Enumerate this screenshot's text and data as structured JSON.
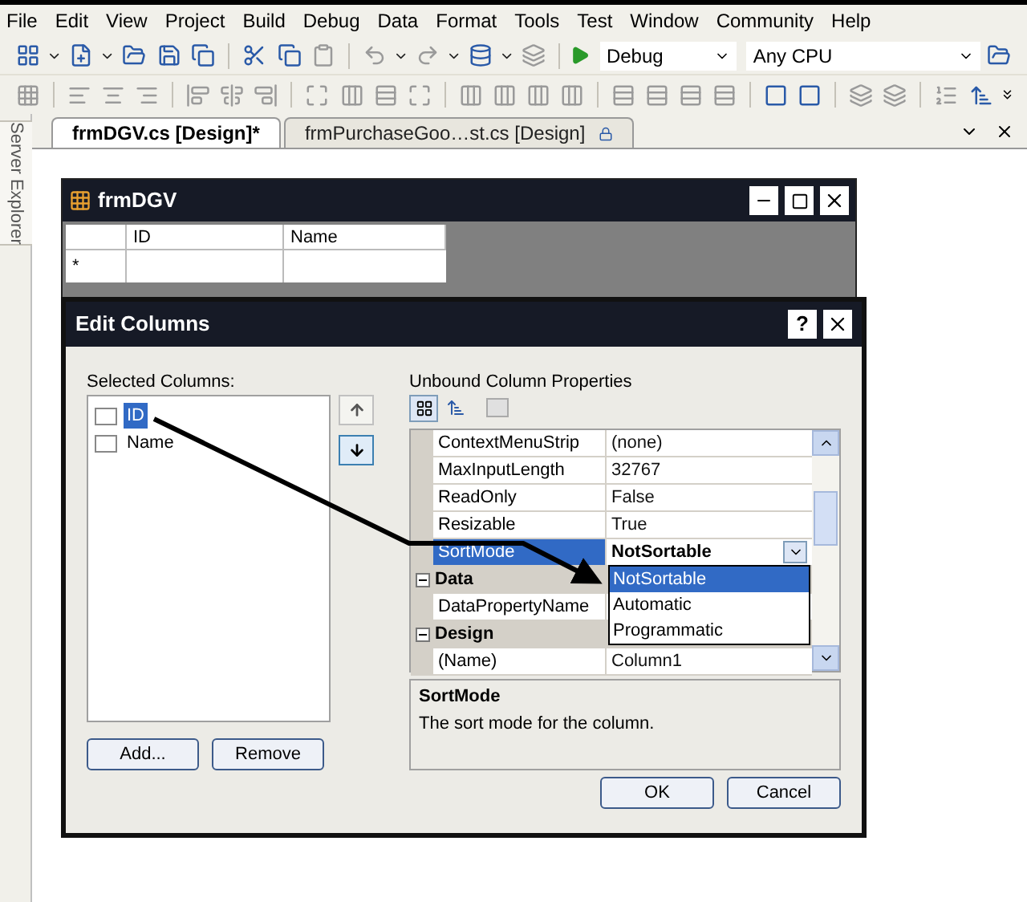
{
  "menu": [
    "File",
    "Edit",
    "View",
    "Project",
    "Build",
    "Debug",
    "Data",
    "Format",
    "Tools",
    "Test",
    "Window",
    "Community",
    "Help"
  ],
  "toolbar": {
    "configuration": "Debug",
    "platform": "Any CPU"
  },
  "tabs": [
    {
      "label": "frmDGV.cs [Design]*",
      "selected": true,
      "locked": false
    },
    {
      "label": "frmPurchaseGoo…st.cs [Design]",
      "selected": false,
      "locked": true
    }
  ],
  "side_panel": {
    "label": "Server Explorer"
  },
  "form": {
    "title": "frmDGV",
    "grid_columns": [
      "ID",
      "Name"
    ],
    "new_row_marker": "*"
  },
  "dialog": {
    "title": "Edit Columns",
    "selected_columns_label": "Selected Columns:",
    "columns": [
      {
        "label": "ID",
        "selected": true
      },
      {
        "label": "Name",
        "selected": false
      }
    ],
    "add_button": "Add...",
    "remove_button": "Remove",
    "properties_label": "Unbound Column Properties",
    "properties": [
      {
        "kind": "row",
        "name": "ContextMenuStrip",
        "value": "(none)",
        "selected": false,
        "modified": false
      },
      {
        "kind": "row",
        "name": "MaxInputLength",
        "value": "32767",
        "selected": false,
        "modified": false
      },
      {
        "kind": "row",
        "name": "ReadOnly",
        "value": "False",
        "selected": false,
        "modified": false
      },
      {
        "kind": "row",
        "name": "Resizable",
        "value": "True",
        "selected": false,
        "modified": false
      },
      {
        "kind": "row",
        "name": "SortMode",
        "value": "NotSortable",
        "selected": true,
        "modified": true
      },
      {
        "kind": "category",
        "name": "Data",
        "expanded": true
      },
      {
        "kind": "row",
        "name": "DataPropertyName",
        "selected": false
      },
      {
        "kind": "category",
        "name": "Design",
        "expanded": true
      },
      {
        "kind": "row",
        "name": "(Name)",
        "value": "Column1",
        "selected": false,
        "modified": false
      }
    ],
    "dropdown_options": [
      {
        "label": "NotSortable",
        "selected": true
      },
      {
        "label": "Automatic",
        "selected": false
      },
      {
        "label": "Programmatic",
        "selected": false
      }
    ],
    "description_title": "SortMode",
    "description": "The sort mode for the column.",
    "ok_button": "OK",
    "cancel_button": "Cancel",
    "help_button": "?"
  }
}
